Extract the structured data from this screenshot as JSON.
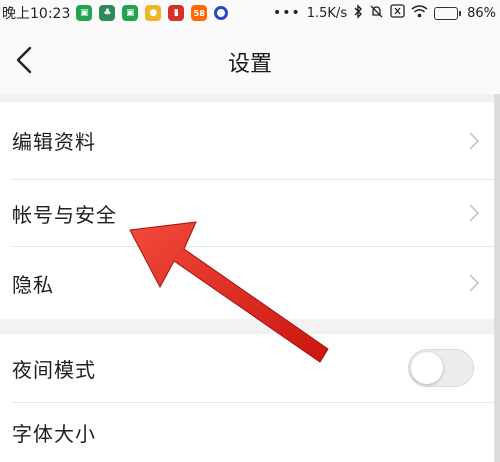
{
  "status_bar": {
    "time": "晚上10:23",
    "network_speed": "1.5K/s",
    "battery_level": "86%",
    "battery_fraction": 0.86,
    "app_icons": [
      {
        "name": "wechat-work-icon",
        "color": "#22a350"
      },
      {
        "name": "tree-app-icon",
        "color": "#2e8b57"
      },
      {
        "name": "wechat-work-icon-2",
        "color": "#22a350"
      },
      {
        "name": "animal-app-icon",
        "color": "#f0b429"
      },
      {
        "name": "red-app-icon",
        "color": "#d93025"
      },
      {
        "name": "58-app-icon",
        "color": "#ff6a00",
        "text": "58"
      },
      {
        "name": "circle-app-icon",
        "color": "#2a45c9"
      }
    ],
    "icons": [
      "bluetooth-icon",
      "mute-icon",
      "close-box-icon",
      "wifi-icon",
      "battery-icon"
    ]
  },
  "nav": {
    "title": "设置",
    "back_icon": "chevron-left-icon"
  },
  "group_account": {
    "items": [
      {
        "label": "编辑资料"
      },
      {
        "label": "帐号与安全"
      },
      {
        "label": "隐私"
      }
    ]
  },
  "group_display": {
    "items": [
      {
        "label": "夜间模式",
        "toggle_on": false
      },
      {
        "label": "字体大小"
      }
    ]
  },
  "annotation": {
    "color": "#e8231c",
    "icon": "red-arrow-annotation"
  }
}
